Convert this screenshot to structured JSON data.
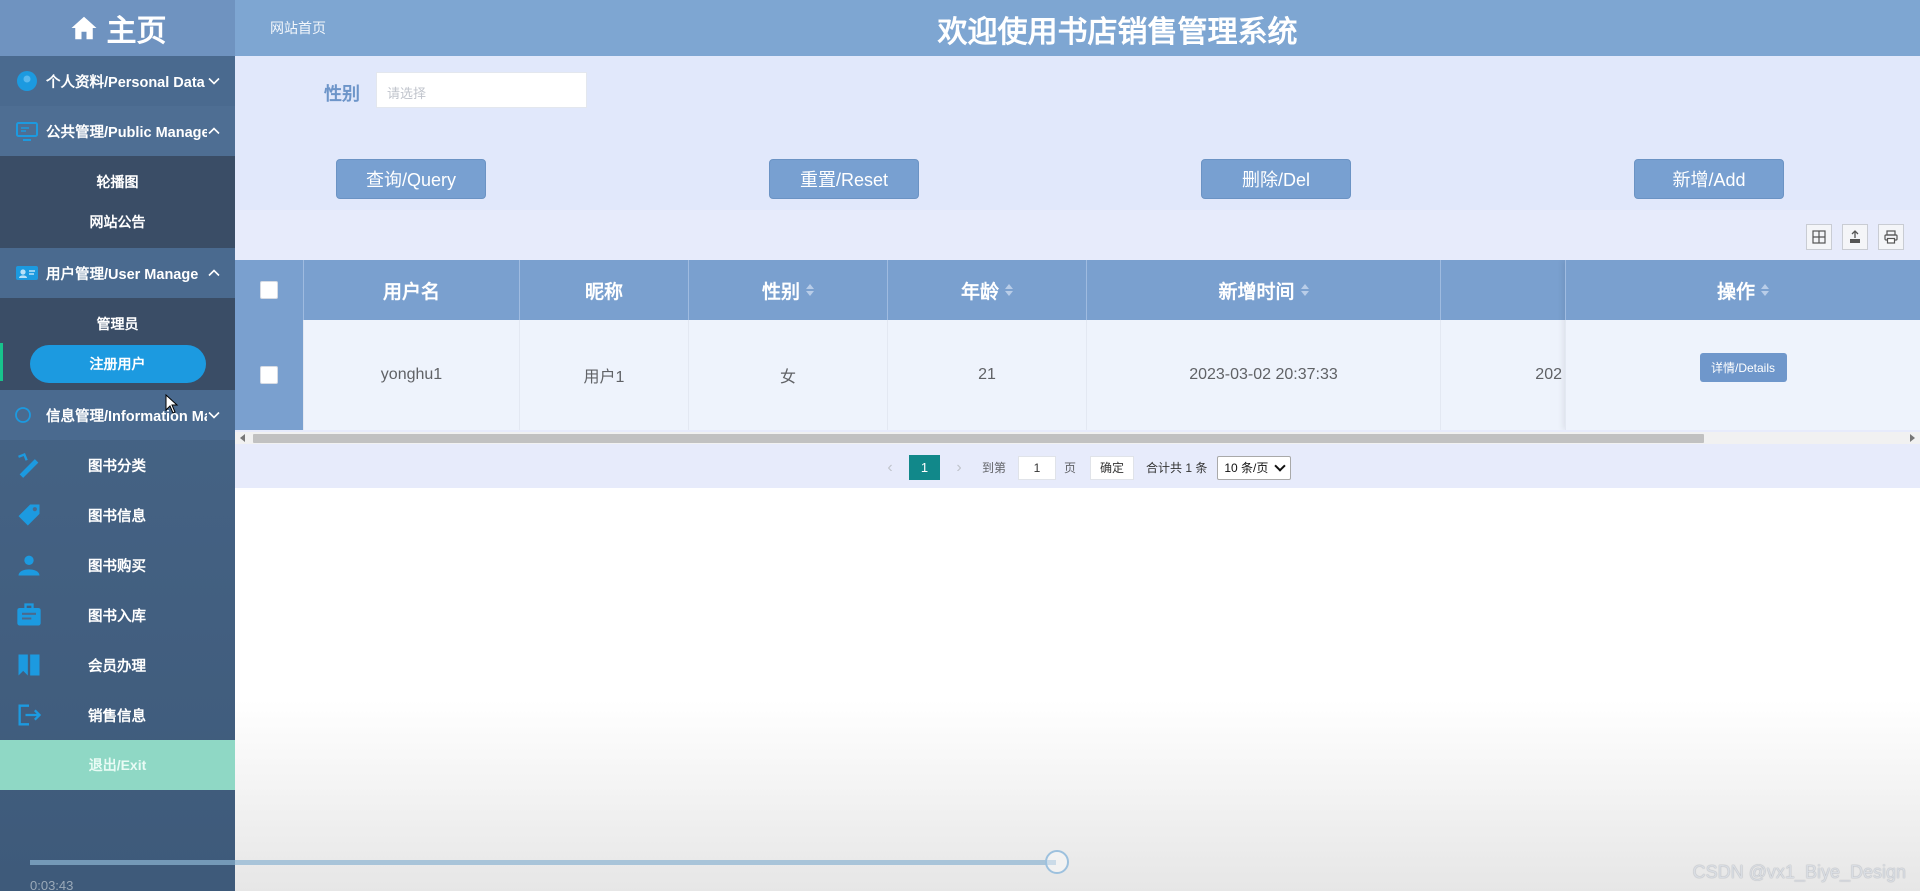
{
  "sidebar": {
    "home_label": "主页",
    "personal": {
      "label": "个人资料/Personal Data"
    },
    "public": {
      "label": "公共管理/Public Manage",
      "items": [
        "轮播图",
        "网站公告"
      ]
    },
    "user": {
      "label": "用户管理/User Manage",
      "items": [
        "管理员",
        "注册用户"
      ],
      "active": "注册用户"
    },
    "info": {
      "label": "信息管理/Information Manage"
    },
    "items": [
      {
        "label": "图书分类",
        "icon": "pencil-ruler-icon"
      },
      {
        "label": "图书信息",
        "icon": "tag-icon"
      },
      {
        "label": "图书购买",
        "icon": "people-icon"
      },
      {
        "label": "图书入库",
        "icon": "id-card-icon"
      },
      {
        "label": "会员办理",
        "icon": "bookmark-icon"
      },
      {
        "label": "销售信息",
        "icon": "logout-arrow-icon"
      }
    ],
    "exit_label": "退出/Exit"
  },
  "header": {
    "breadcrumb": "网站首页",
    "title": "欢迎使用书店销售管理系统"
  },
  "search": {
    "gender_label": "性别",
    "gender_placeholder": "请选择"
  },
  "actions": {
    "query": "查询/Query",
    "reset": "重置/Reset",
    "delete": "删除/Del",
    "add": "新增/Add"
  },
  "table": {
    "columns": [
      "用户名",
      "昵称",
      "性别",
      "年龄",
      "新增时间",
      "操作"
    ],
    "rows": [
      {
        "username": "yonghu1",
        "nickname": "用户1",
        "gender": "女",
        "age": "21",
        "created": "2023-03-02 20:37:33",
        "partial": "202",
        "action": "详情/Details"
      }
    ]
  },
  "pager": {
    "current_page": "1",
    "goto_label": "到第",
    "goto_value": "1",
    "page_unit": "页",
    "confirm": "确定",
    "total": "合计共 1 条",
    "page_size": "10 条/页"
  },
  "video": {
    "time": "0:03:43",
    "progress": 0.69
  },
  "watermark": "CSDN @vx1_Biye_Design",
  "colors": {
    "sidebar": "#4b6a8d",
    "header": "#7ea6d2",
    "accent_button": "#78a0d1",
    "active_pill": "#1c9ae0",
    "page_current": "#11888a",
    "exit": "#8fd8c5"
  }
}
